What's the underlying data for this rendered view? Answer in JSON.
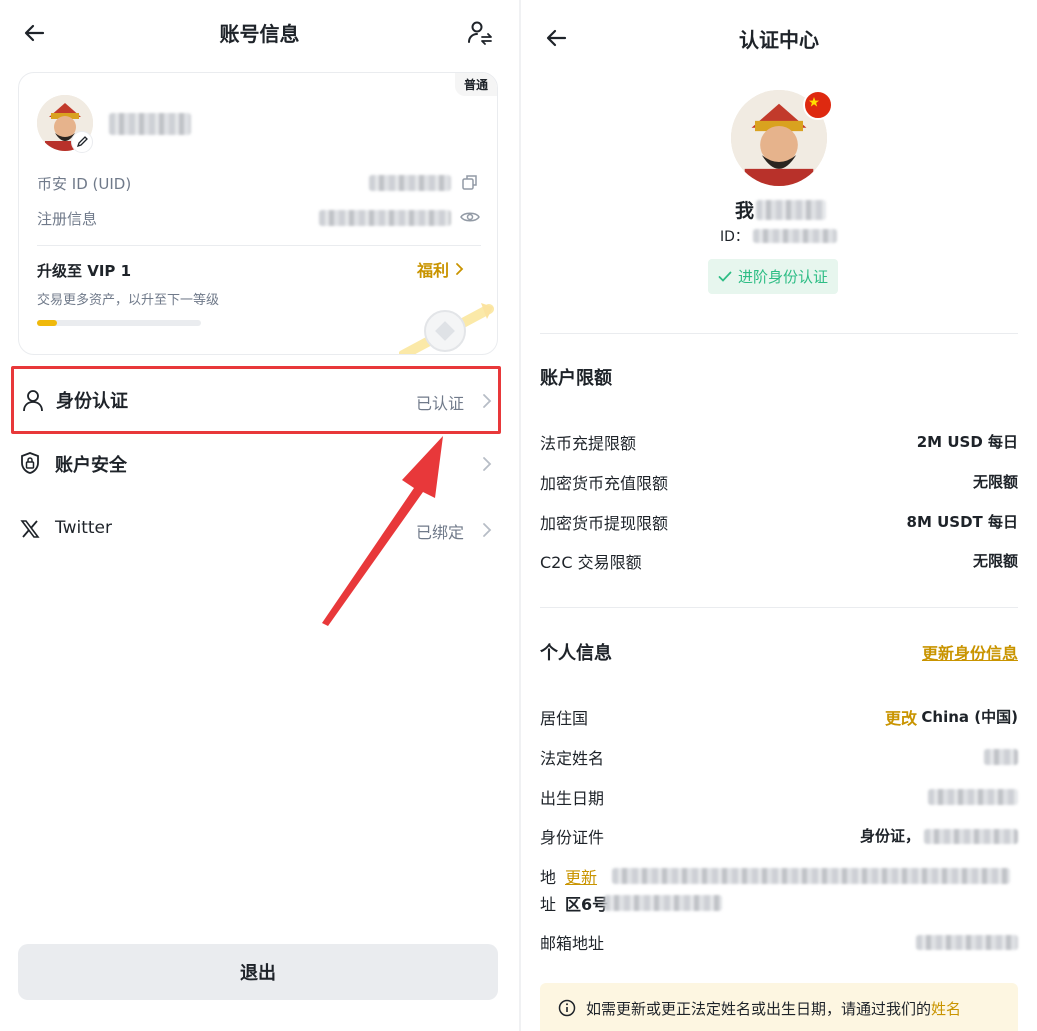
{
  "left": {
    "header": {
      "title": "账号信息"
    },
    "card": {
      "badge": "普通",
      "uid_label": "币安 ID (UID)",
      "reg_label": "注册信息",
      "vip_title": "升级至 VIP 1",
      "vip_sub": "交易更多资产，以升至下一等级",
      "benefit_label": "福利",
      "progress": 0.12,
      "accent": "#f0b90b"
    },
    "menu": [
      {
        "label": "身份认证",
        "value": "已认证",
        "icon": "person-icon"
      },
      {
        "label": "账户安全",
        "value": "",
        "icon": "shield-lock-icon"
      },
      {
        "label": "Twitter",
        "value": "已绑定",
        "icon": "x-twitter-icon"
      }
    ],
    "logout_label": "退出"
  },
  "right": {
    "header": {
      "title": "认证中心"
    },
    "profile": {
      "name_prefix": "我",
      "id_label": "ID：",
      "status_label": "进阶身份认证"
    },
    "limits": {
      "title": "账户限额",
      "rows": [
        {
          "label": "法币充提限额",
          "value": "2M USD 每日"
        },
        {
          "label": "加密货币充值限额",
          "value": "无限额"
        },
        {
          "label": "加密货币提现限额",
          "value": "8M USDT 每日"
        },
        {
          "label": "C2C 交易限额",
          "value": "无限额"
        }
      ]
    },
    "personal": {
      "title": "个人信息",
      "update_link": "更新身份信息",
      "residence_label": "居住国",
      "residence_change": "更改",
      "residence_value": "China (中国)",
      "legal_name_label": "法定姓名",
      "birth_label": "出生日期",
      "id_doc_label": "身份证件",
      "id_doc_value": "身份证，",
      "address_label_1": "地",
      "address_label_2": "址",
      "address_update": "更新",
      "address_line2_prefix": "区6号",
      "email_label": "邮箱地址"
    },
    "notice": {
      "text": "如需更新或更正法定姓名或出生日期，请通过我们的",
      "link": "姓名"
    }
  }
}
